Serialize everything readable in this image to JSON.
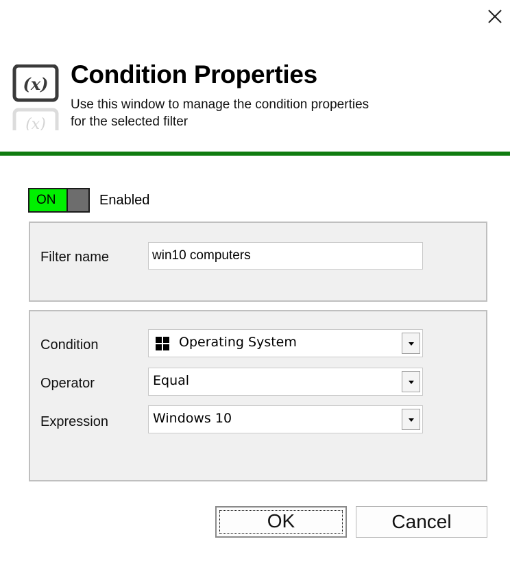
{
  "window": {
    "title": "Condition Properties",
    "subtitle_line1": "Use this window to manage the condition properties",
    "subtitle_line2": "for the selected filter"
  },
  "header_icon": {
    "glyph": "(x)",
    "icon_name": "variable-icon"
  },
  "colors": {
    "divider": "#107c10",
    "toggle_on": "#00f000",
    "toggle_off": "#6d6d6d",
    "group_background": "#f0f0f0"
  },
  "toggle": {
    "state_label": "ON",
    "enabled_label": "Enabled"
  },
  "filter": {
    "name_label": "Filter name",
    "name_value": "win10 computers"
  },
  "condition": {
    "condition_label": "Condition",
    "condition_value": "Operating System",
    "condition_icon": "windows-logo-icon",
    "operator_label": "Operator",
    "operator_value": "Equal",
    "expression_label": "Expression",
    "expression_value": "Windows 10"
  },
  "buttons": {
    "ok_label": "OK",
    "cancel_label": "Cancel"
  }
}
